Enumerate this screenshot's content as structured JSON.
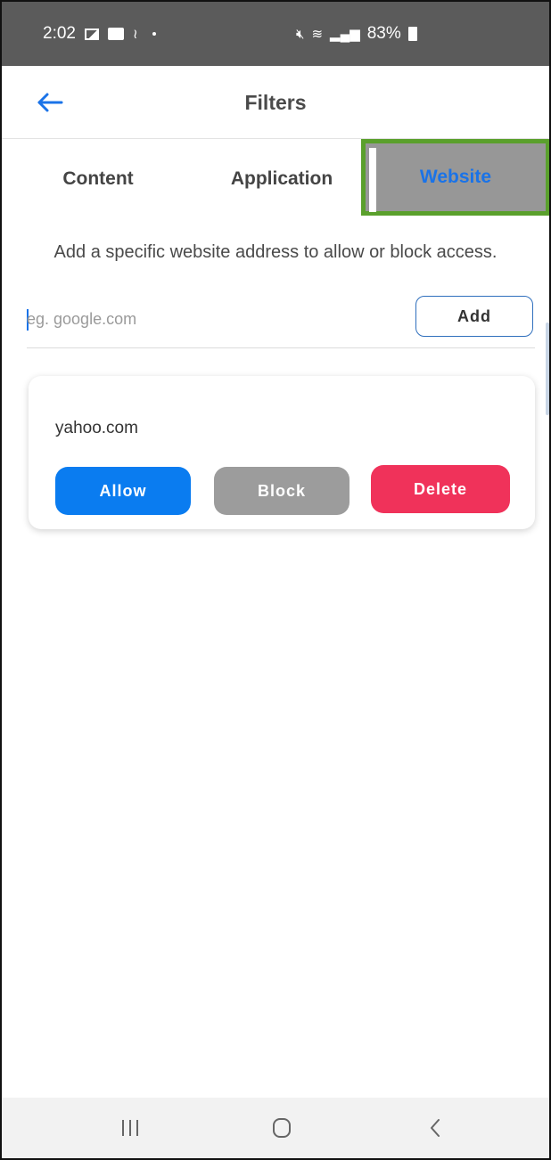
{
  "status_bar": {
    "time": "2:02",
    "battery_percent": "83%",
    "left_icons": [
      "photo-icon",
      "calendar-icon",
      "satellite-icon",
      "notification-dot-icon"
    ],
    "right_icons": [
      "mute-icon",
      "wifi-calling-icon",
      "signal-4g-icon",
      "battery-icon"
    ]
  },
  "header": {
    "title": "Filters",
    "back_icon": "back-arrow-icon"
  },
  "tabs": [
    {
      "label": "Content",
      "selected": false
    },
    {
      "label": "Application",
      "selected": false
    },
    {
      "label": "Website",
      "selected": true
    }
  ],
  "description": "Add a specific website address to allow or block access.",
  "input": {
    "placeholder": "eg. google.com",
    "value": "",
    "add_label": "Add"
  },
  "sites": [
    {
      "name": "yahoo.com",
      "allow_label": "Allow",
      "block_label": "Block",
      "delete_label": "Delete"
    }
  ],
  "nav": {
    "recents_icon": "recents-icon",
    "home_icon": "home-icon",
    "back_icon": "back-chevron-icon"
  },
  "colors": {
    "status_bar": "#5b5b5b",
    "accent_blue": "#1a73e8",
    "allow": "#0a7cf0",
    "block": "#9c9c9c",
    "delete": "#f0325a",
    "selected_tab_bg": "#979797",
    "highlight_border": "#5aa02c"
  }
}
